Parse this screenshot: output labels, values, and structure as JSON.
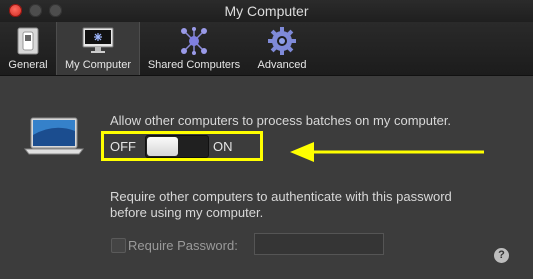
{
  "window": {
    "title": "My Computer"
  },
  "toolbar": {
    "tabs": [
      {
        "label": "General",
        "icon": "switch-icon"
      },
      {
        "label": "My Computer",
        "icon": "imac-icon",
        "selected": true
      },
      {
        "label": "Shared Computers",
        "icon": "network-icon"
      },
      {
        "label": "Advanced",
        "icon": "gear-icon"
      }
    ]
  },
  "content": {
    "allow_text": "Allow other computers to process batches on my computer.",
    "toggle": {
      "off_label": "OFF",
      "on_label": "ON",
      "state": "off"
    },
    "require_auth_line1": "Require other computers to authenticate with this password",
    "require_auth_line2": "before using my computer.",
    "require_password_label": "Require Password:",
    "require_password_value": "",
    "help_label": "?"
  },
  "colors": {
    "highlight": "#ffff00",
    "arrow": "#ffff00",
    "background": "#3c3c3c"
  }
}
